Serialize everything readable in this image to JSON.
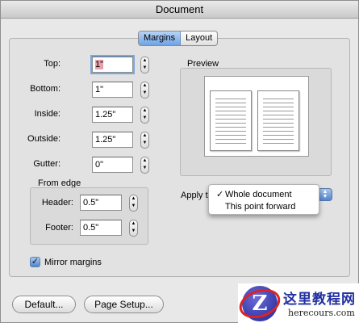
{
  "window": {
    "title": "Document"
  },
  "tabs": [
    {
      "label": "Margins",
      "active": true
    },
    {
      "label": "Layout",
      "active": false
    }
  ],
  "margins": {
    "top": {
      "label": "Top:",
      "value": "1\""
    },
    "bottom": {
      "label": "Bottom:",
      "value": "1\""
    },
    "inside": {
      "label": "Inside:",
      "value": "1.25\""
    },
    "outside": {
      "label": "Outside:",
      "value": "1.25\""
    },
    "gutter": {
      "label": "Gutter:",
      "value": "0\""
    }
  },
  "from_edge": {
    "title": "From edge",
    "header": {
      "label": "Header:",
      "value": "0.5\""
    },
    "footer": {
      "label": "Footer:",
      "value": "0.5\""
    }
  },
  "preview": {
    "title": "Preview"
  },
  "apply_to": {
    "label": "Apply to",
    "options": [
      {
        "label": "Whole document",
        "checked": true,
        "mark": "✓"
      },
      {
        "label": "This point forward",
        "checked": false
      }
    ]
  },
  "mirror_margins": {
    "label": "Mirror margins",
    "checked": true
  },
  "buttons": {
    "default": "Default...",
    "page_setup": "Page Setup..."
  },
  "watermark": {
    "logo_letter": "Z",
    "title": "这里教程网",
    "url": "herecours.com"
  },
  "colors": {
    "accent": "#6fa3e6",
    "selection": "#e8a0a8",
    "watermark_blue": "#2230a0",
    "watermark_red": "#dd2222"
  }
}
